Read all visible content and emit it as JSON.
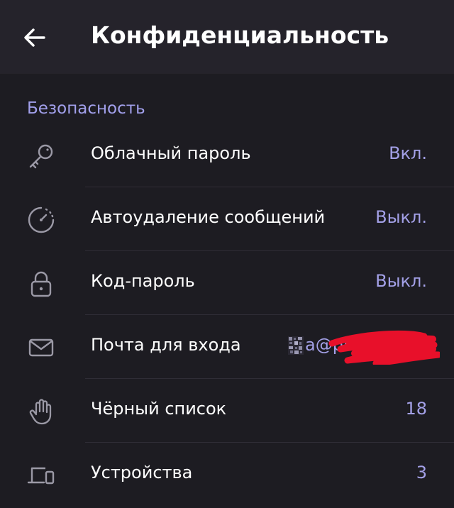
{
  "header": {
    "title": "Конфиденциальность",
    "back_icon": "arrow-left-icon"
  },
  "section": {
    "title": "Безопасность"
  },
  "items": [
    {
      "icon": "key-icon",
      "label": "Облачный пароль",
      "value": "Вкл."
    },
    {
      "icon": "timer-icon",
      "label": "Автоудаление сообщений",
      "value": "Выкл."
    },
    {
      "icon": "lock-icon",
      "label": "Код-пароль",
      "value": "Выкл."
    },
    {
      "icon": "mail-icon",
      "label": "Почта для входа",
      "value": "a@pro"
    },
    {
      "icon": "hand-icon",
      "label": "Чёрный список",
      "value": "18"
    },
    {
      "icon": "devices-icon",
      "label": "Устройства",
      "value": "3"
    }
  ],
  "colors": {
    "header_bg": "#25232b",
    "content_bg": "#1d1c22",
    "accent": "#a2a0ec",
    "text": "#ffffff",
    "icon": "#9b99a6",
    "redaction": "#e8102a"
  }
}
